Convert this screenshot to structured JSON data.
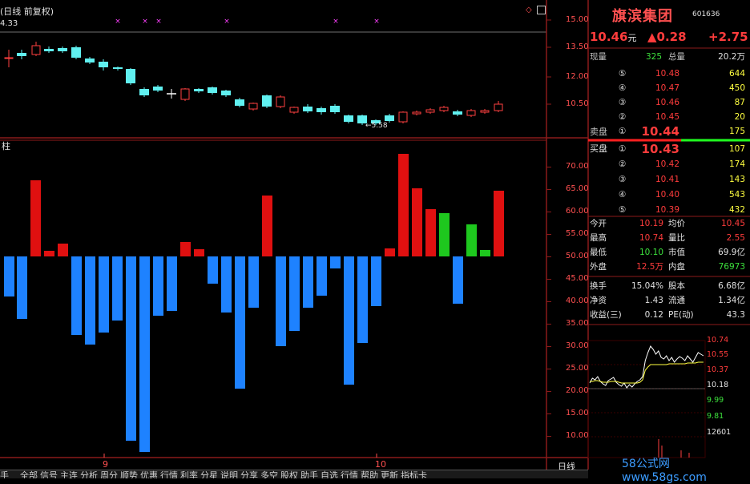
{
  "header": {
    "title": "(日线 前复权)",
    "left_value": "4.33",
    "ticker": "601636",
    "logo_text": "旗滨集团"
  },
  "candle_panel": {
    "price_axis": [
      "15.00",
      "13.50",
      "12.00",
      "10.50"
    ],
    "low_marker": "5.58"
  },
  "indicator_panel": {
    "label": "柱",
    "axis": [
      "70.00",
      "65.00",
      "60.00",
      "55.00",
      "50.00",
      "45.00",
      "40.00",
      "35.00",
      "30.00",
      "25.00",
      "20.00",
      "15.00",
      "10.00"
    ]
  },
  "x_axis": {
    "labels": [
      "9",
      "10"
    ],
    "period_label": "日线"
  },
  "quote": {
    "price": "10.46",
    "price_unit": "元",
    "change": "▲0.28",
    "change_pct": "+2.75",
    "volume_label": "现量",
    "volume_value": "325",
    "total_label": "总量",
    "total_value": "20.2万",
    "sell_label": "卖盘",
    "buy_label": "买盘",
    "sells": [
      {
        "idx": "⑤",
        "price": "10.48",
        "vol": "644"
      },
      {
        "idx": "④",
        "price": "10.47",
        "vol": "450"
      },
      {
        "idx": "③",
        "price": "10.46",
        "vol": "87"
      },
      {
        "idx": "②",
        "price": "10.45",
        "vol": "20"
      },
      {
        "idx": "①",
        "price": "10.44",
        "vol": "175"
      }
    ],
    "buys": [
      {
        "idx": "①",
        "price": "10.43",
        "vol": "107"
      },
      {
        "idx": "②",
        "price": "10.42",
        "vol": "174"
      },
      {
        "idx": "③",
        "price": "10.41",
        "vol": "143"
      },
      {
        "idx": "④",
        "price": "10.40",
        "vol": "543"
      },
      {
        "idx": "⑤",
        "price": "10.39",
        "vol": "432"
      }
    ],
    "stats": [
      {
        "l1": "今开",
        "v1": "10.19",
        "l2": "均价",
        "v2": "10.45"
      },
      {
        "l1": "最高",
        "v1": "10.74",
        "l2": "量比",
        "v2": "2.55"
      },
      {
        "l1": "最低",
        "v1": "10.10",
        "l2": "市值",
        "v2": "69.9亿"
      },
      {
        "l1": "外盘",
        "v1": "12.5万",
        "l2": "内盘",
        "v2": "76973"
      }
    ],
    "stats2": [
      {
        "l1": "换手",
        "v1": "15.04%",
        "l2": "股本",
        "v2": "6.68亿"
      },
      {
        "l1": "净资",
        "v1": "1.43",
        "l2": "流通",
        "v2": "1.34亿"
      },
      {
        "l1": "收益(三)",
        "v1": "0.12",
        "l2": "PE(动)",
        "v2": "43.3"
      }
    ],
    "mini_axis": [
      "10.74",
      "10.55",
      "10.37",
      "10.18",
      "9.99",
      "9.81",
      "12601"
    ]
  },
  "navbar": {
    "items": [
      "手",
      "全部",
      "信号",
      "主连",
      "分析",
      "周分",
      "顺势",
      "优惠",
      "行情",
      "利率",
      "分星",
      "说明",
      "分享",
      "多空",
      "股权",
      "助手",
      "自选",
      "行情",
      "帮助",
      "更新",
      "指标卡"
    ]
  },
  "watermark": "58公式网 www.58gs.com",
  "colors": {
    "up": "#e01010",
    "down": "#1e82ff",
    "green": "#1ec81e",
    "cyan": "#60f0f0",
    "grid": "#8b1a1a"
  }
}
